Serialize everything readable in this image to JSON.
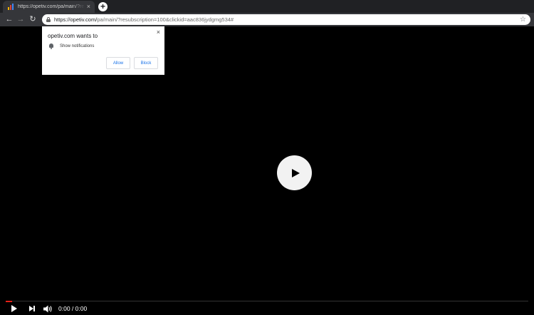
{
  "browser": {
    "tab": {
      "title": "https://opetiv.com/pa/main/?resu",
      "close": "×",
      "new_tab": "+",
      "favicon_icon": "bar-chart-icon"
    },
    "toolbar": {
      "back": "←",
      "forward": "→",
      "reload": "↻",
      "url_host": "https://opetiv.com/",
      "url_path": "pa/main/?resubscription=100&clickid=aac836jydgmg534#",
      "star": "☆"
    }
  },
  "prompt": {
    "title": "opetiv.com wants to",
    "permission": "Show notifications",
    "allow": "Allow",
    "block": "Block",
    "close": "×",
    "icon": "bell-icon",
    "accent": "#1a73e8"
  },
  "player": {
    "time": "0:00 / 0:00",
    "progress": 0.012,
    "progress_color": "#e62117"
  }
}
